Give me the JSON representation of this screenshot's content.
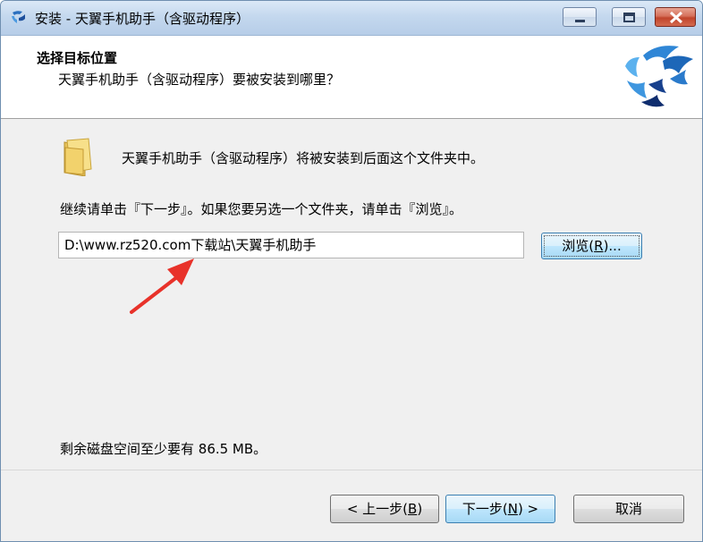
{
  "window": {
    "title": "安装 - 天翼手机助手（含驱动程序）"
  },
  "header": {
    "title": "选择目标位置",
    "subtitle": "天翼手机助手（含驱动程序）要被安装到哪里？"
  },
  "body": {
    "folder_message": "天翼手机助手（含驱动程序）将被安装到后面这个文件夹中。",
    "continue_message": "继续请单击『下一步』。如果您要另选一个文件夹，请单击『浏览』。",
    "install_path": "D:\\www.rz520.com下载站\\天翼手机助手",
    "browse_label_pre": "浏览(",
    "browse_label_key": "R",
    "browse_label_post": ")...",
    "disk_space": "剩余磁盘空间至少要有 86.5 MB。"
  },
  "footer": {
    "back_pre": "< 上一步(",
    "back_key": "B",
    "back_post": ")",
    "next_pre": "下一步(",
    "next_key": "N",
    "next_post": ") >",
    "cancel_label": "取消"
  },
  "icons": {
    "app": "app-logo-icon",
    "folder": "folder-icon",
    "annotation": "red-arrow-annotation"
  },
  "colors": {
    "accent": "#3c7fb1",
    "arrow": "#e8322a"
  }
}
